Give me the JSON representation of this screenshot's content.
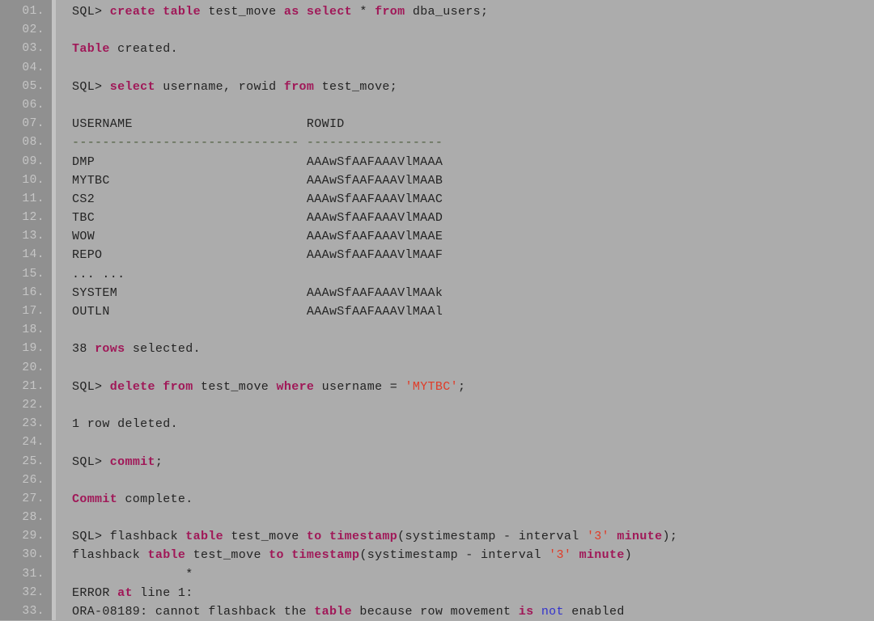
{
  "window": {
    "title": "SQL*Plus Session Transcript",
    "background_color": "#acacac",
    "gutter_color": "#909090",
    "gutter_separator_color": "#c3c3c3",
    "line_number_color": "#c6c6c6",
    "text_color": "#232323"
  },
  "palette": {
    "keyword": "#a01858",
    "string": "#e03c28",
    "operator_not": "#3333cc",
    "rule_dashes": "#4d5c3d",
    "plain": "#232323"
  },
  "listing": {
    "total_lines": 33,
    "first_line_number": "01.",
    "last_line_number": "33.",
    "lines": [
      {
        "num": "01.",
        "plain": "SQL> create table test_move as select * from dba_users;",
        "tokens": [
          {
            "t": "SQL> ",
            "c": "txt"
          },
          {
            "t": "create table",
            "c": "kw"
          },
          {
            "t": " test_move ",
            "c": "txt"
          },
          {
            "t": "as select",
            "c": "kw"
          },
          {
            "t": " * ",
            "c": "txt"
          },
          {
            "t": "from",
            "c": "kw"
          },
          {
            "t": " dba_users;",
            "c": "txt"
          }
        ]
      },
      {
        "num": "02.",
        "plain": "",
        "tokens": []
      },
      {
        "num": "03.",
        "plain": "Table created.",
        "tokens": [
          {
            "t": "Table",
            "c": "kw"
          },
          {
            "t": " created.",
            "c": "txt"
          }
        ]
      },
      {
        "num": "04.",
        "plain": "",
        "tokens": []
      },
      {
        "num": "05.",
        "plain": "SQL> select username, rowid from test_move;",
        "tokens": [
          {
            "t": "SQL> ",
            "c": "txt"
          },
          {
            "t": "select",
            "c": "kw"
          },
          {
            "t": " username, rowid ",
            "c": "txt"
          },
          {
            "t": "from",
            "c": "kw"
          },
          {
            "t": " test_move;",
            "c": "txt"
          }
        ]
      },
      {
        "num": "06.",
        "plain": "",
        "tokens": []
      },
      {
        "num": "07.",
        "plain": "USERNAME                       ROWID",
        "tokens": [
          {
            "t": "USERNAME                       ROWID",
            "c": "txt"
          }
        ]
      },
      {
        "num": "08.",
        "plain": "------------------------------ ------------------",
        "tokens": [
          {
            "t": "------------------------------ ------------------",
            "c": "rule"
          }
        ]
      },
      {
        "num": "09.",
        "plain": "DMP                            AAAwSfAAFAAAVlMAAA",
        "tokens": [
          {
            "t": "DMP                            AAAwSfAAFAAAVlMAAA",
            "c": "txt"
          }
        ]
      },
      {
        "num": "10.",
        "plain": "MYTBC                          AAAwSfAAFAAAVlMAAB",
        "tokens": [
          {
            "t": "MYTBC                          AAAwSfAAFAAAVlMAAB",
            "c": "txt"
          }
        ]
      },
      {
        "num": "11.",
        "plain": "CS2                            AAAwSfAAFAAAVlMAAC",
        "tokens": [
          {
            "t": "CS2                            AAAwSfAAFAAAVlMAAC",
            "c": "txt"
          }
        ]
      },
      {
        "num": "12.",
        "plain": "TBC                            AAAwSfAAFAAAVlMAAD",
        "tokens": [
          {
            "t": "TBC                            AAAwSfAAFAAAVlMAAD",
            "c": "txt"
          }
        ]
      },
      {
        "num": "13.",
        "plain": "WOW                            AAAwSfAAFAAAVlMAAE",
        "tokens": [
          {
            "t": "WOW                            AAAwSfAAFAAAVlMAAE",
            "c": "txt"
          }
        ]
      },
      {
        "num": "14.",
        "plain": "REPO                           AAAwSfAAFAAAVlMAAF",
        "tokens": [
          {
            "t": "REPO                           AAAwSfAAFAAAVlMAAF",
            "c": "txt"
          }
        ]
      },
      {
        "num": "15.",
        "plain": "... ...",
        "tokens": [
          {
            "t": "... ...",
            "c": "txt"
          }
        ]
      },
      {
        "num": "16.",
        "plain": "SYSTEM                         AAAwSfAAFAAAVlMAAk",
        "tokens": [
          {
            "t": "SYSTEM                         AAAwSfAAFAAAVlMAAk",
            "c": "txt"
          }
        ]
      },
      {
        "num": "17.",
        "plain": "OUTLN                          AAAwSfAAFAAAVlMAAl",
        "tokens": [
          {
            "t": "OUTLN                          AAAwSfAAFAAAVlMAAl",
            "c": "txt"
          }
        ]
      },
      {
        "num": "18.",
        "plain": "",
        "tokens": []
      },
      {
        "num": "19.",
        "plain": "38 rows selected.",
        "tokens": [
          {
            "t": "38 ",
            "c": "txt"
          },
          {
            "t": "rows",
            "c": "kw"
          },
          {
            "t": " selected.",
            "c": "txt"
          }
        ]
      },
      {
        "num": "20.",
        "plain": "",
        "tokens": []
      },
      {
        "num": "21.",
        "plain": "SQL> delete from test_move where username = 'MYTBC';",
        "tokens": [
          {
            "t": "SQL> ",
            "c": "txt"
          },
          {
            "t": "delete from",
            "c": "kw"
          },
          {
            "t": " test_move ",
            "c": "txt"
          },
          {
            "t": "where",
            "c": "kw"
          },
          {
            "t": " username = ",
            "c": "txt"
          },
          {
            "t": "'MYTBC'",
            "c": "str"
          },
          {
            "t": ";",
            "c": "txt"
          }
        ]
      },
      {
        "num": "22.",
        "plain": "",
        "tokens": []
      },
      {
        "num": "23.",
        "plain": "1 row deleted.",
        "tokens": [
          {
            "t": "1 row deleted.",
            "c": "txt"
          }
        ]
      },
      {
        "num": "24.",
        "plain": "",
        "tokens": []
      },
      {
        "num": "25.",
        "plain": "SQL> commit;",
        "tokens": [
          {
            "t": "SQL> ",
            "c": "txt"
          },
          {
            "t": "commit",
            "c": "kw"
          },
          {
            "t": ";",
            "c": "txt"
          }
        ]
      },
      {
        "num": "26.",
        "plain": "",
        "tokens": []
      },
      {
        "num": "27.",
        "plain": "Commit complete.",
        "tokens": [
          {
            "t": "Commit",
            "c": "kw"
          },
          {
            "t": " complete.",
            "c": "txt"
          }
        ]
      },
      {
        "num": "28.",
        "plain": "",
        "tokens": []
      },
      {
        "num": "29.",
        "plain": "SQL> flashback table test_move to timestamp(systimestamp - interval '3' minute);",
        "tokens": [
          {
            "t": "SQL> flashback ",
            "c": "txt"
          },
          {
            "t": "table",
            "c": "kw"
          },
          {
            "t": " test_move ",
            "c": "txt"
          },
          {
            "t": "to timestamp",
            "c": "kw"
          },
          {
            "t": "(systimestamp - interval ",
            "c": "txt"
          },
          {
            "t": "'3'",
            "c": "str"
          },
          {
            "t": " ",
            "c": "txt"
          },
          {
            "t": "minute",
            "c": "kw"
          },
          {
            "t": ");",
            "c": "txt"
          }
        ]
      },
      {
        "num": "30.",
        "plain": "flashback table test_move to timestamp(systimestamp - interval '3' minute)",
        "tokens": [
          {
            "t": "flashback ",
            "c": "txt"
          },
          {
            "t": "table",
            "c": "kw"
          },
          {
            "t": " test_move ",
            "c": "txt"
          },
          {
            "t": "to timestamp",
            "c": "kw"
          },
          {
            "t": "(systimestamp - interval ",
            "c": "txt"
          },
          {
            "t": "'3'",
            "c": "str"
          },
          {
            "t": " ",
            "c": "txt"
          },
          {
            "t": "minute",
            "c": "kw"
          },
          {
            "t": ")",
            "c": "txt"
          }
        ]
      },
      {
        "num": "31.",
        "plain": "               *",
        "tokens": [
          {
            "t": "               *",
            "c": "txt"
          }
        ]
      },
      {
        "num": "32.",
        "plain": "ERROR at line 1:",
        "tokens": [
          {
            "t": "ERROR ",
            "c": "txt"
          },
          {
            "t": "at",
            "c": "kw"
          },
          {
            "t": " line 1:",
            "c": "txt"
          }
        ]
      },
      {
        "num": "33.",
        "plain": "ORA-08189: cannot flashback the table because row movement is not enabled",
        "tokens": [
          {
            "t": "ORA-08189: cannot flashback the ",
            "c": "txt"
          },
          {
            "t": "table",
            "c": "kw"
          },
          {
            "t": " because row movement ",
            "c": "txt"
          },
          {
            "t": "is",
            "c": "kw"
          },
          {
            "t": " ",
            "c": "txt"
          },
          {
            "t": "not",
            "c": "not"
          },
          {
            "t": " enabled",
            "c": "txt"
          }
        ]
      }
    ]
  }
}
